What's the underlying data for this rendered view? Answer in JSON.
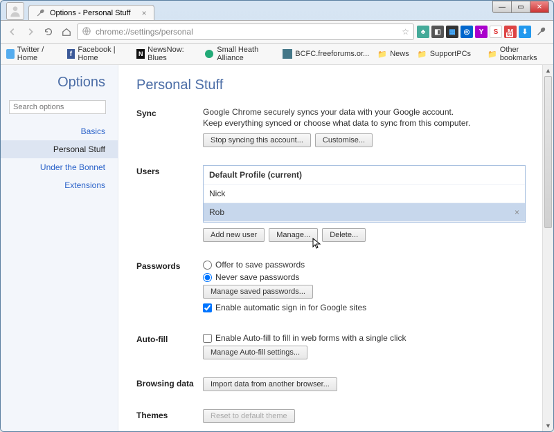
{
  "window": {
    "tab_title": "Options - Personal Stuff",
    "min": "—",
    "max": "▭",
    "close": "✕"
  },
  "toolbar": {
    "url": "chrome://settings/personal",
    "star": "☆"
  },
  "bookmarks": {
    "items": [
      {
        "label": "Twitter / Home",
        "color": "#55acee"
      },
      {
        "label": "Facebook | Home",
        "color": "#3b5998"
      },
      {
        "label": "NewsNow: Blues",
        "color": "#111"
      },
      {
        "label": "Small Heath Alliance",
        "color": "#2a7"
      },
      {
        "label": "BCFC.freeforums.or...",
        "color": "#478"
      },
      {
        "label": "News",
        "color": "#e8b84a"
      },
      {
        "label": "SupportPCs",
        "color": "#e8b84a"
      }
    ],
    "other": "Other bookmarks"
  },
  "sidebar": {
    "title": "Options",
    "search_placeholder": "Search options",
    "items": [
      "Basics",
      "Personal Stuff",
      "Under the Bonnet",
      "Extensions"
    ],
    "active_index": 1
  },
  "page": {
    "title": "Personal Stuff"
  },
  "sync": {
    "label": "Sync",
    "line1": "Google Chrome securely syncs your data with your Google account.",
    "line2": "Keep everything synced or choose what data to sync from this computer.",
    "stop_btn": "Stop syncing this account...",
    "customise_btn": "Customise..."
  },
  "users": {
    "label": "Users",
    "rows": [
      {
        "name": "Default Profile (current)",
        "current": true,
        "selected": false
      },
      {
        "name": "Nick",
        "current": false,
        "selected": false
      },
      {
        "name": "Rob",
        "current": false,
        "selected": true
      }
    ],
    "add_btn": "Add new user",
    "manage_btn": "Manage...",
    "delete_btn": "Delete..."
  },
  "passwords": {
    "label": "Passwords",
    "offer": "Offer to save passwords",
    "never": "Never save passwords",
    "selected": "never",
    "manage_btn": "Manage saved passwords...",
    "auto_signin": "Enable automatic sign in for Google sites",
    "auto_signin_checked": true
  },
  "autofill": {
    "label": "Auto-fill",
    "enable": "Enable Auto-fill to fill in web forms with a single click",
    "enable_checked": false,
    "manage_btn": "Manage Auto-fill settings..."
  },
  "browsing": {
    "label": "Browsing data",
    "import_btn": "Import data from another browser..."
  },
  "themes": {
    "label": "Themes",
    "reset_btn": "Reset to default theme"
  }
}
